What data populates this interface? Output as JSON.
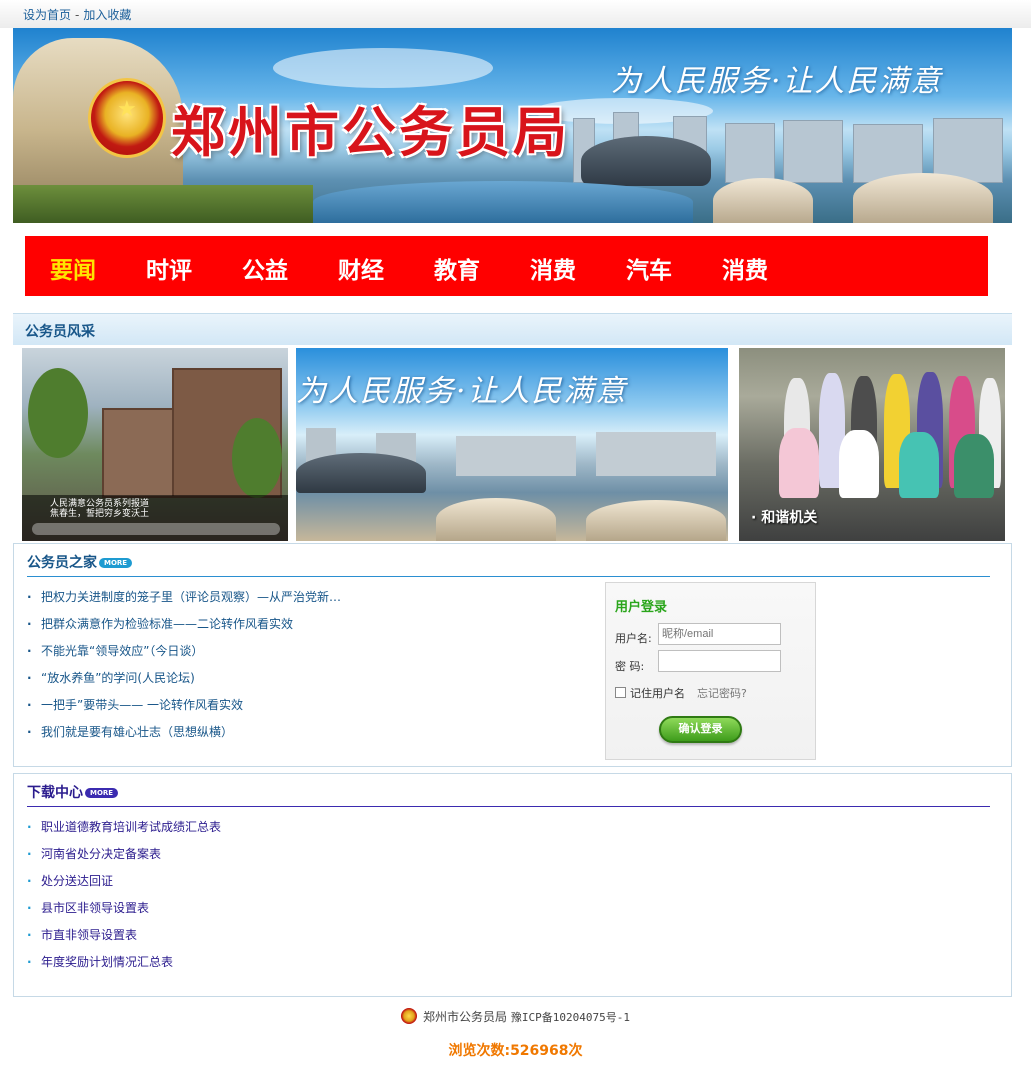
{
  "topbar": {
    "set_home": "设为首页",
    "separator": "-",
    "bookmark": "加入收藏"
  },
  "banner": {
    "title": "郑州市公务员局",
    "slogan": "为人民服务·让人民满意"
  },
  "nav": {
    "items": [
      "要闻",
      "时评",
      "公益",
      "财经",
      "教育",
      "消费",
      "汽车",
      "消费"
    ],
    "active_index": 0
  },
  "gallery": {
    "section_title": "公务员风采",
    "photo1_caption_line1": "人民满意公务员系列报道",
    "photo1_caption_line2": "焦春生，誓把穷乡变沃土",
    "photo2_slogan": "为人民服务·让人民满意",
    "photo3_label": "· 和谐机关"
  },
  "home_section": {
    "title": "公务员之家",
    "more_label": "MORE",
    "items": [
      "把权力关进制度的笼子里（评论员观察）—从严治党新…",
      "把群众满意作为检验标准——二论转作风看实效",
      "不能光靠“领导效应”（今日谈）",
      "“放水养鱼”的学问(人民论坛)",
      "一把手”要带头—— 一论转作风看实效",
      "我们就是要有雄心壮志（思想纵横）"
    ]
  },
  "login": {
    "title": "用户登录",
    "username_label": "用户名:",
    "username_placeholder": "昵称/email",
    "password_label": "密 码:",
    "remember_label": "记住用户名",
    "forgot_label": "忘记密码?",
    "submit_label": "确认登录"
  },
  "download_section": {
    "title": "下载中心",
    "more_label": "MORE",
    "items": [
      "职业道德教育培训考试成绩汇总表",
      "河南省处分决定备案表",
      "处分送达回证",
      "县市区非领导设置表",
      "市直非领导设置表",
      "年度奖励计划情况汇总表"
    ]
  },
  "footer": {
    "org": "郑州市公务员局",
    "icp": "豫ICP备10204075号-1",
    "visits": "浏览次数:526968次"
  },
  "colors": {
    "nav_bg": "#ff0000",
    "nav_active": "#ffe400",
    "home_title": "#185689",
    "download_title": "#2b1c8e",
    "login_title": "#2aa51b",
    "counter": "#f07800"
  }
}
